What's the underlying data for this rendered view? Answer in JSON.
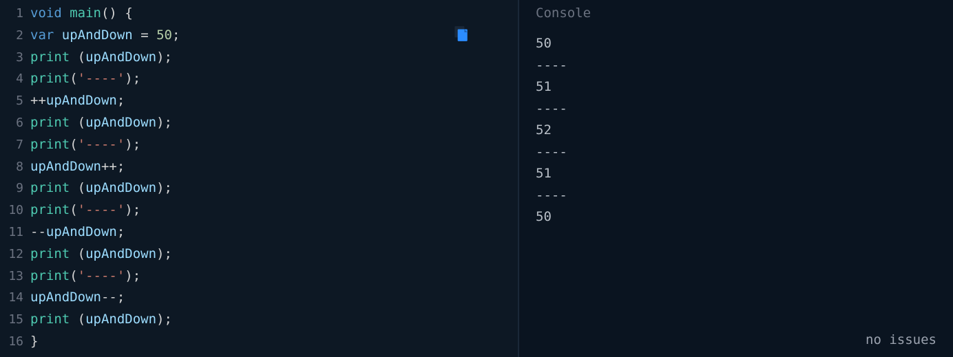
{
  "editor": {
    "lines": [
      {
        "num": "1",
        "tokens": [
          [
            "keyword",
            "void"
          ],
          [
            "plain",
            " "
          ],
          [
            "func",
            "main"
          ],
          [
            "punct",
            "()"
          ],
          [
            "plain",
            " "
          ],
          [
            "punct",
            "{"
          ]
        ]
      },
      {
        "num": "2",
        "tokens": [
          [
            "keyword",
            "var"
          ],
          [
            "plain",
            " "
          ],
          [
            "ident2",
            "upAndDown"
          ],
          [
            "plain",
            " "
          ],
          [
            "punct",
            "="
          ],
          [
            "plain",
            " "
          ],
          [
            "number",
            "50"
          ],
          [
            "punct",
            ";"
          ]
        ]
      },
      {
        "num": "3",
        "tokens": [
          [
            "func",
            "print"
          ],
          [
            "plain",
            " "
          ],
          [
            "punct",
            "("
          ],
          [
            "ident2",
            "upAndDown"
          ],
          [
            "punct",
            ");"
          ]
        ]
      },
      {
        "num": "4",
        "tokens": [
          [
            "func",
            "print"
          ],
          [
            "punct",
            "("
          ],
          [
            "string",
            "'----'"
          ],
          [
            "punct",
            ");"
          ]
        ]
      },
      {
        "num": "5",
        "tokens": [
          [
            "punct",
            "++"
          ],
          [
            "ident2",
            "upAndDown"
          ],
          [
            "punct",
            ";"
          ]
        ]
      },
      {
        "num": "6",
        "tokens": [
          [
            "func",
            "print"
          ],
          [
            "plain",
            " "
          ],
          [
            "punct",
            "("
          ],
          [
            "ident2",
            "upAndDown"
          ],
          [
            "punct",
            ");"
          ]
        ]
      },
      {
        "num": "7",
        "tokens": [
          [
            "func",
            "print"
          ],
          [
            "punct",
            "("
          ],
          [
            "string",
            "'----'"
          ],
          [
            "punct",
            ");"
          ]
        ]
      },
      {
        "num": "8",
        "tokens": [
          [
            "ident2",
            "upAndDown"
          ],
          [
            "punct",
            "++;"
          ]
        ]
      },
      {
        "num": "9",
        "tokens": [
          [
            "func",
            "print"
          ],
          [
            "plain",
            " "
          ],
          [
            "punct",
            "("
          ],
          [
            "ident2",
            "upAndDown"
          ],
          [
            "punct",
            ");"
          ]
        ]
      },
      {
        "num": "10",
        "tokens": [
          [
            "func",
            "print"
          ],
          [
            "punct",
            "("
          ],
          [
            "string",
            "'----'"
          ],
          [
            "punct",
            ");"
          ]
        ]
      },
      {
        "num": "11",
        "tokens": [
          [
            "punct",
            "--"
          ],
          [
            "ident2",
            "upAndDown"
          ],
          [
            "punct",
            ";"
          ]
        ]
      },
      {
        "num": "12",
        "tokens": [
          [
            "func",
            "print"
          ],
          [
            "plain",
            " "
          ],
          [
            "punct",
            "("
          ],
          [
            "ident2",
            "upAndDown"
          ],
          [
            "punct",
            ");"
          ]
        ]
      },
      {
        "num": "13",
        "tokens": [
          [
            "func",
            "print"
          ],
          [
            "punct",
            "("
          ],
          [
            "string",
            "'----'"
          ],
          [
            "punct",
            ");"
          ]
        ]
      },
      {
        "num": "14",
        "tokens": [
          [
            "ident2",
            "upAndDown"
          ],
          [
            "punct",
            "--;"
          ]
        ]
      },
      {
        "num": "15",
        "tokens": [
          [
            "func",
            "print"
          ],
          [
            "plain",
            " "
          ],
          [
            "punct",
            "("
          ],
          [
            "ident2",
            "upAndDown"
          ],
          [
            "punct",
            ");"
          ]
        ]
      },
      {
        "num": "16",
        "tokens": [
          [
            "punct",
            "}"
          ]
        ]
      }
    ]
  },
  "console": {
    "title": "Console",
    "output": [
      "50",
      "----",
      "51",
      "----",
      "52",
      "----",
      "51",
      "----",
      "50"
    ]
  },
  "status": {
    "text": "no issues"
  }
}
